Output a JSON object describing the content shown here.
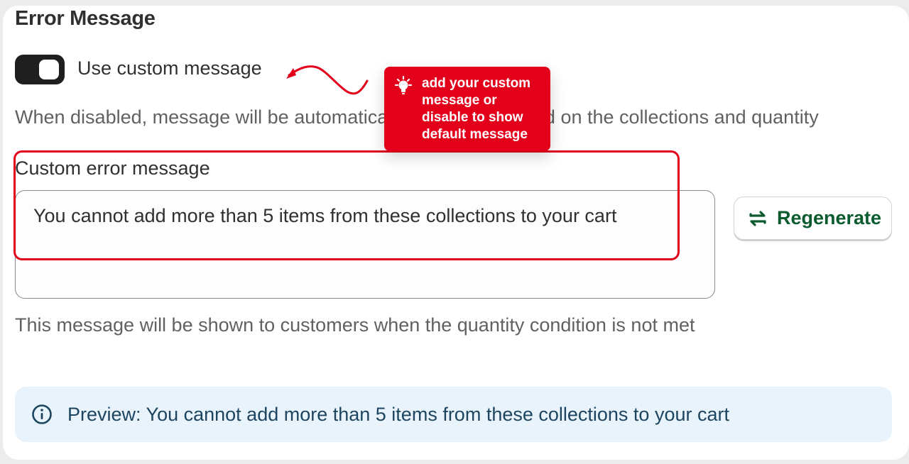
{
  "section": {
    "title": "Error Message"
  },
  "toggle": {
    "label": "Use custom message",
    "state": "on"
  },
  "help_text": "When disabled, message will be automatically generated based on the collections and quantity",
  "custom_field": {
    "label": "Custom error message",
    "value": "You cannot add more than 5 items from these collections to your cart",
    "help": "This message will be shown to customers when the quantity condition is not met"
  },
  "regenerate": {
    "label": "Regenerate",
    "icon": "refresh-icon"
  },
  "preview": {
    "text": "Preview: You cannot add more than 5 items from these collections to your cart",
    "icon": "info-icon"
  },
  "annotation": {
    "tip": "add your custom message or disable to show default message",
    "icon": "lightbulb-icon",
    "color": "#e3001b"
  },
  "colors": {
    "accent_green": "#0b5b2e",
    "preview_bg": "#e9f3fb",
    "toggle_on": "#1f1f1f"
  }
}
